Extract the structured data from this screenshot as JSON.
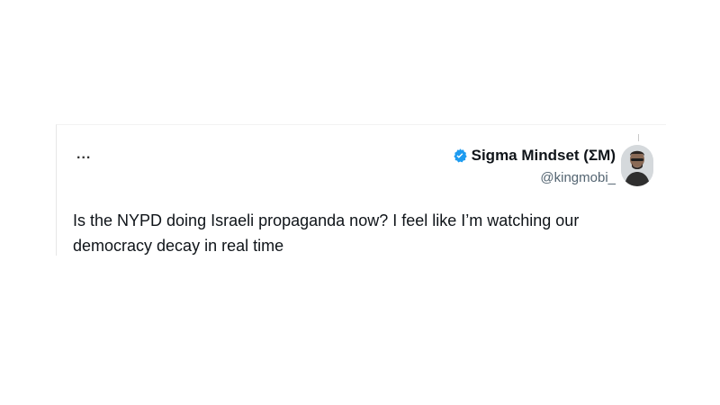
{
  "tweet": {
    "more_label": "...",
    "author": {
      "display_name": "Sigma Mindset (ΣM)",
      "handle": "@kingmobi_",
      "verified_icon": "verified-badge-icon",
      "verified_color": "#1d9bf0"
    },
    "text": "Is the NYPD doing Israeli propaganda now? I feel like I’m watching our democracy decay in real time"
  }
}
